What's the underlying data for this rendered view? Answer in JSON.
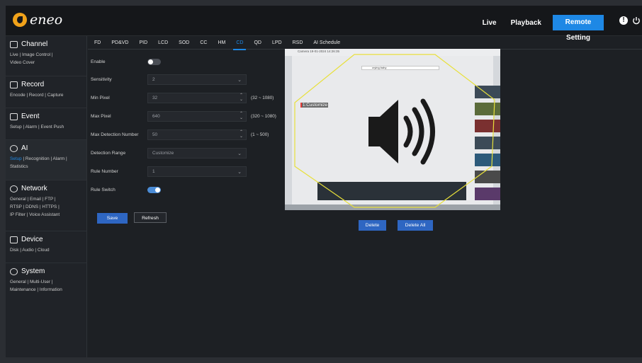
{
  "brand": {
    "name": "eneo"
  },
  "topnav": {
    "live": "Live",
    "playback": "Playback",
    "remote_setting": "Remote Setting"
  },
  "sidebar": {
    "channel": {
      "title": "Channel",
      "links": [
        "Live",
        "Image Control",
        "Video Cover"
      ]
    },
    "record": {
      "title": "Record",
      "links": [
        "Encode",
        "Record",
        "Capture"
      ]
    },
    "event": {
      "title": "Event",
      "links": [
        "Setup",
        "Alarm",
        "Event Push"
      ]
    },
    "ai": {
      "title": "AI",
      "links": [
        "Setup",
        "Recognition",
        "Alarm",
        "Statistics"
      ]
    },
    "network": {
      "title": "Network",
      "links": [
        "General",
        "Email",
        "FTP",
        "RTSP",
        "DDNS",
        "HTTPS",
        "IP Filter",
        "Voice Assistant"
      ]
    },
    "device": {
      "title": "Device",
      "links": [
        "Disk",
        "Audio",
        "Cloud"
      ]
    },
    "system": {
      "title": "System",
      "links": [
        "General",
        "Multi-User",
        "Maintenance",
        "Information"
      ]
    }
  },
  "tabs": [
    "FD",
    "PD&VD",
    "PID",
    "LCD",
    "SOD",
    "CC",
    "HM",
    "CD",
    "QD",
    "LPD",
    "RSD",
    "AI Schedule"
  ],
  "active_tab": "CD",
  "form": {
    "enable": {
      "label": "Enable",
      "value": false
    },
    "sensitivity": {
      "label": "Sensitivity",
      "value": "2"
    },
    "min_pixel": {
      "label": "Min Pixel",
      "value": "32",
      "range": "(32 ~ 1080)"
    },
    "max_pixel": {
      "label": "Max Pixel",
      "value": "640",
      "range": "(320 ~ 1080)"
    },
    "max_detection_number": {
      "label": "Max Detection Number",
      "value": "50",
      "range": "(1 ~ 500)"
    },
    "detection_range": {
      "label": "Detection Range",
      "value": "Customize"
    },
    "rule_number": {
      "label": "Rule Number",
      "value": "1"
    },
    "rule_switch": {
      "label": "Rule Switch",
      "value": true
    }
  },
  "buttons": {
    "save": "Save",
    "refresh": "Refresh",
    "delete": "Delete",
    "delete_all": "Delete All"
  },
  "preview": {
    "region_label": "1:Customize",
    "cam_title": "Camera 19-01-2024 14:26:35",
    "search_text": "crying baby"
  },
  "colors": {
    "accent": "#1e88e5",
    "region_outline": "#e8e03a",
    "brand": "#f0a21a"
  },
  "icons": [
    "channel-icon",
    "record-icon",
    "event-icon",
    "ai-icon",
    "network-icon",
    "device-icon",
    "system-icon",
    "info-icon",
    "power-icon",
    "speaker-icon"
  ]
}
